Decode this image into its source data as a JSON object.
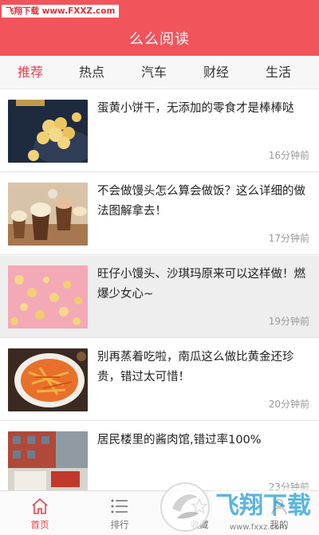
{
  "watermark": {
    "text": "飞翔下载 www.FXXZ.com"
  },
  "header": {
    "title": "么么阅读"
  },
  "tabs": [
    {
      "label": "推荐",
      "active": true
    },
    {
      "label": "热点",
      "active": false
    },
    {
      "label": "汽车",
      "active": false
    },
    {
      "label": "财经",
      "active": false
    },
    {
      "label": "生活",
      "active": false
    }
  ],
  "articles": [
    {
      "title": "蛋黄小饼干，无添加的零食才是棒棒哒",
      "time": "16分钟前"
    },
    {
      "title": "不会做馒头怎么算会做饭？这么详细的做法图解拿去！",
      "time": "17分钟前"
    },
    {
      "title": "旺仔小馒头、沙琪玛原来可以这样做！燃爆少女心~",
      "time": "19分钟前"
    },
    {
      "title": "别再蒸着吃啦，南瓜这么做比黄金还珍贵，错过太可惜！",
      "time": "20分钟前"
    },
    {
      "title": "居民楼里的酱肉馆,错过率100%",
      "time": "23分钟前"
    }
  ],
  "bottom_nav": [
    {
      "label": "首页",
      "icon": "home-icon",
      "active": true
    },
    {
      "label": "排行",
      "icon": "list-icon",
      "active": false
    },
    {
      "label": "收藏",
      "icon": "star-icon",
      "active": false
    },
    {
      "label": "我的",
      "icon": "user-icon",
      "active": false
    }
  ],
  "overlay_logo": {
    "text": "飞翔下载",
    "url": "www.fxxz.com"
  },
  "colors": {
    "brand": "#f2545b",
    "active_tab": "#e8454f",
    "highlight_row": "#eeeeee"
  }
}
